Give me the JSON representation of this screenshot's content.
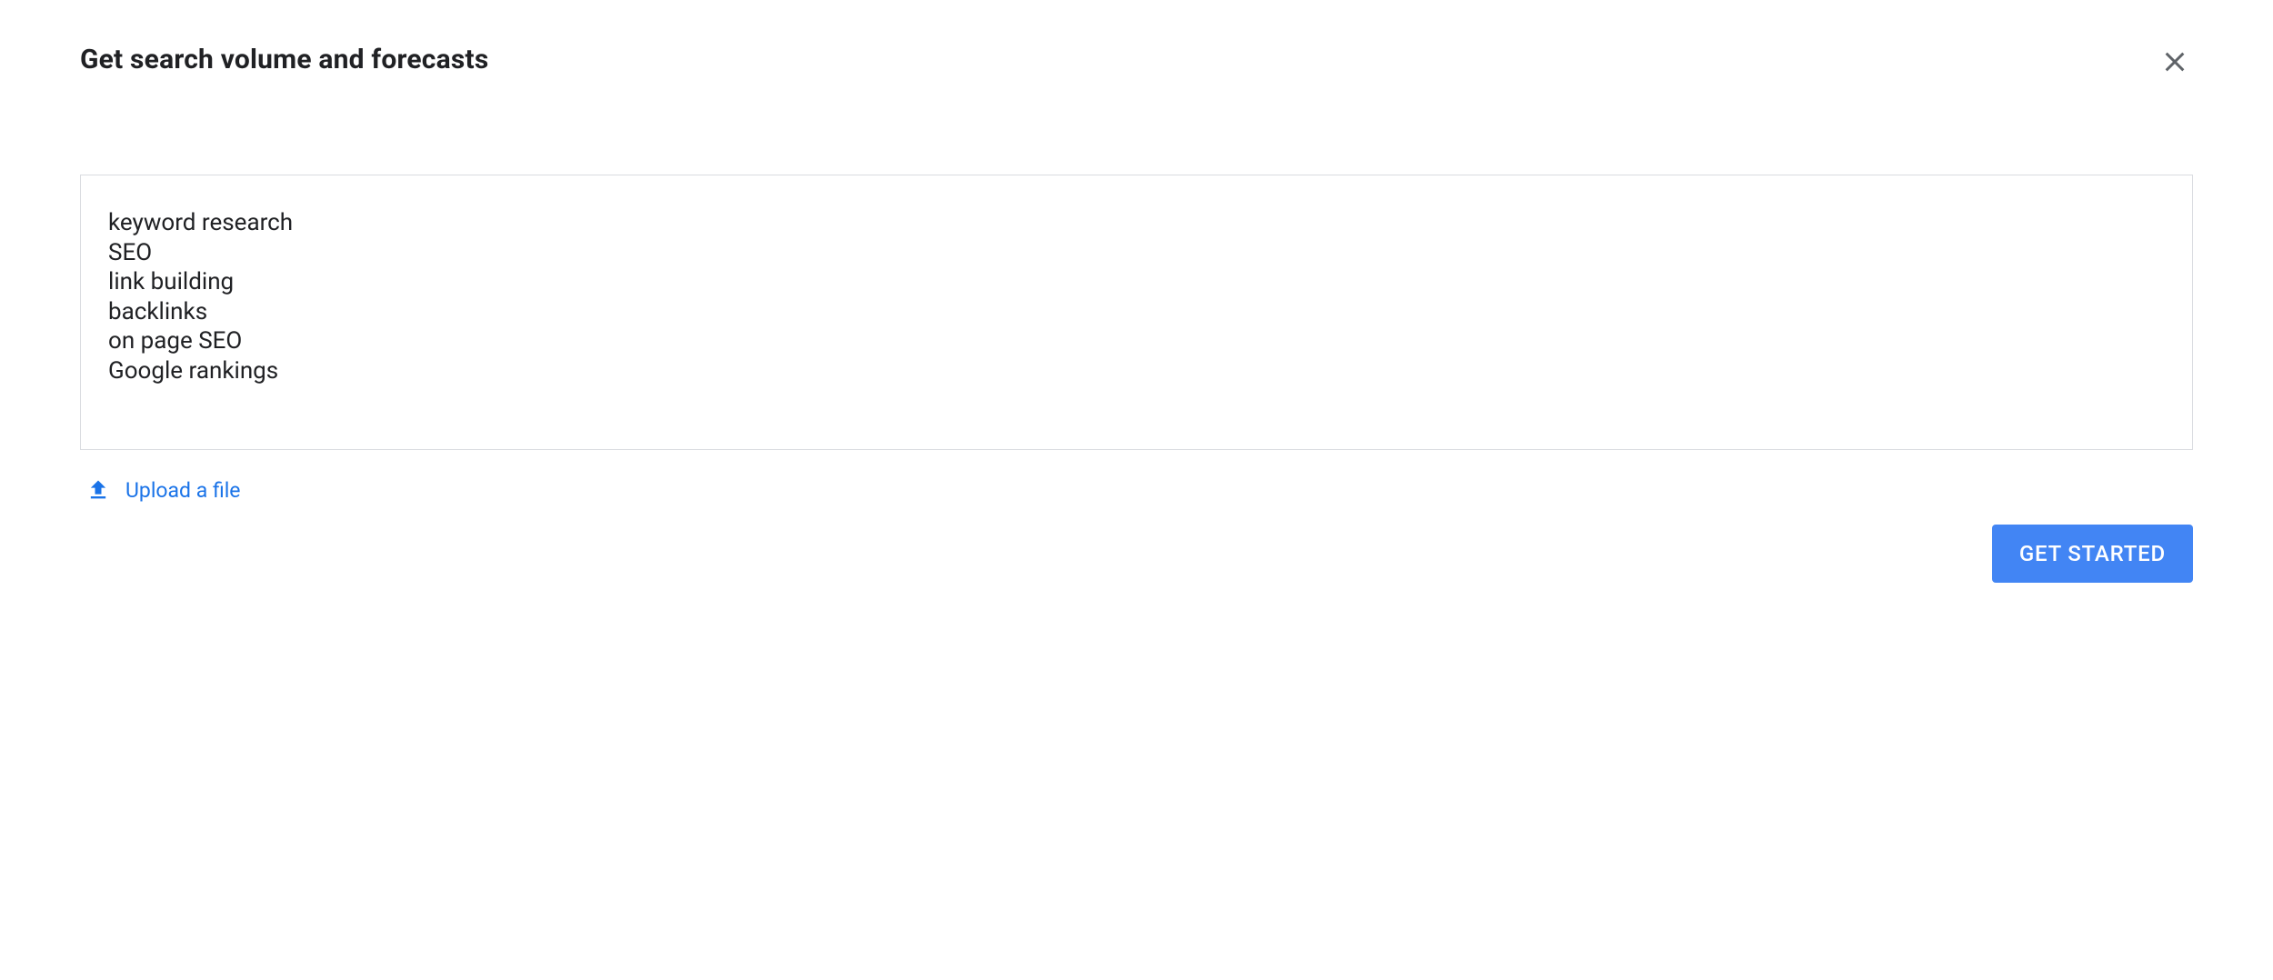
{
  "header": {
    "title": "Get search volume and forecasts"
  },
  "input": {
    "keywords": "keyword research\nSEO\nlink building\nbacklinks\non page SEO\nGoogle rankings"
  },
  "upload": {
    "label": "Upload a file"
  },
  "actions": {
    "get_started_label": "GET STARTED"
  }
}
